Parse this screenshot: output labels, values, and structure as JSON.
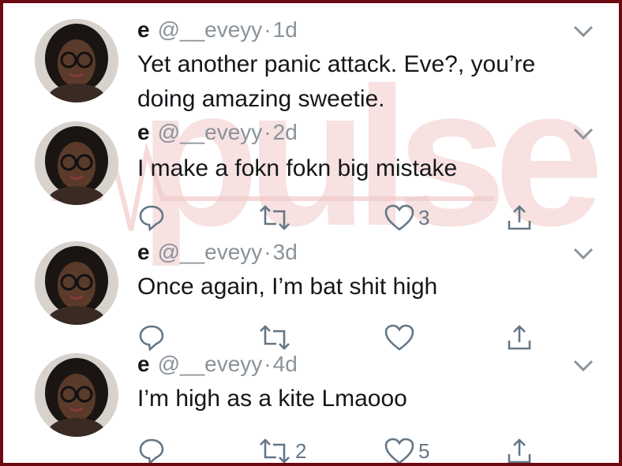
{
  "feed": {
    "tweets": [
      {
        "name": "e",
        "handle": "@__eveyy",
        "separator": "·",
        "time": "1d",
        "text_lines": [
          "Yet another panic attack. Eve?, you’re",
          "doing amazing sweetie."
        ],
        "actions": null
      },
      {
        "name": "e",
        "handle": "@__eveyy",
        "separator": "·",
        "time": "2d",
        "text_lines": [
          "I make a fokn fokn big mistake"
        ],
        "actions": {
          "replies": "",
          "retweets": "",
          "likes": "3"
        }
      },
      {
        "name": "e",
        "handle": "@__eveyy",
        "separator": "·",
        "time": "3d",
        "text_lines": [
          "Once again, I’m bat shit high"
        ],
        "actions": {
          "replies": "",
          "retweets": "",
          "likes": ""
        }
      },
      {
        "name": "e",
        "handle": "@__eveyy",
        "separator": "·",
        "time": "4d",
        "text_lines": [
          "I’m high as a kite Lmaooo"
        ],
        "actions": {
          "replies": "",
          "retweets": "2",
          "likes": "5"
        }
      }
    ]
  },
  "watermark": {
    "text": "pulse"
  },
  "colors": {
    "frame": "#6e0a12",
    "text": "#14171a",
    "muted": "#8a939b",
    "icon": "#657786",
    "watermark": "#f2c9c9"
  },
  "icons": [
    "reply-icon",
    "retweet-icon",
    "like-icon",
    "share-icon",
    "chevron-down-icon"
  ]
}
